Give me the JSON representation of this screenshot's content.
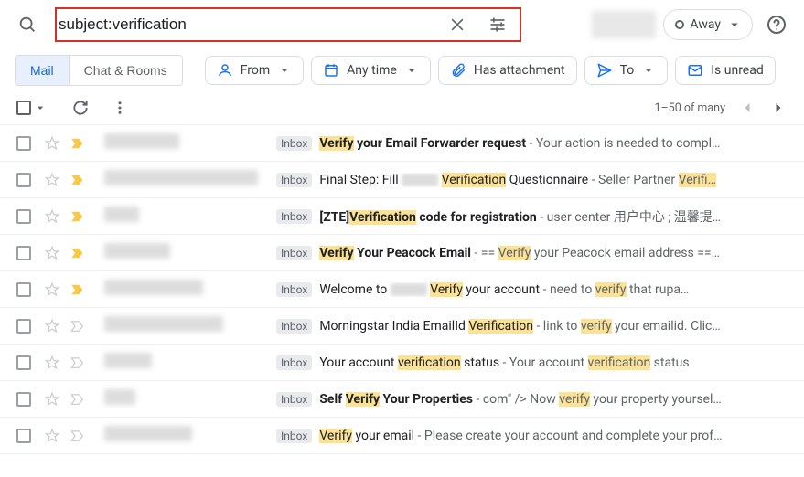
{
  "search": {
    "value": "subject:verification"
  },
  "status_chip": {
    "label": "Away"
  },
  "tabs": {
    "mail": "Mail",
    "chat": "Chat & Rooms"
  },
  "chips": {
    "from": "From",
    "anytime": "Any time",
    "has_attachment": "Has attachment",
    "to": "To",
    "is_unread": "Is unread"
  },
  "pager": {
    "range": "1–50 of many"
  },
  "inbox_label": "Inbox",
  "rows": [
    {
      "important": true,
      "sender_blur_width": 82,
      "bold": true,
      "segments": [
        {
          "t": "Verify",
          "cls": "s-bold hl"
        },
        {
          "t": " your Email Forwarder request",
          "cls": "s-bold"
        },
        {
          "t": " - Your action is needed to compl…",
          "cls": "s-prev"
        }
      ]
    },
    {
      "important": true,
      "sender_blur_width": 168,
      "bold": false,
      "segments": [
        {
          "t": "Final Step: Fill ",
          "cls": "s-reg"
        },
        {
          "blur": true
        },
        {
          "t": " ",
          "cls": "s-reg"
        },
        {
          "t": "Verification",
          "cls": "s-reg hl"
        },
        {
          "t": " Questionnaire",
          "cls": "s-reg"
        },
        {
          "t": " - Seller Partner ",
          "cls": "s-prev"
        },
        {
          "t": "Verifi…",
          "cls": "s-prev hl"
        }
      ]
    },
    {
      "important": true,
      "sender_blur_width": 38,
      "bold": true,
      "segments": [
        {
          "t": "[ZTE]",
          "cls": "s-bold"
        },
        {
          "t": "Verification",
          "cls": "s-bold hl"
        },
        {
          "t": " code for registration",
          "cls": "s-bold"
        },
        {
          "t": " - user center 用户中心 ; 温馨提…",
          "cls": "s-prev"
        }
      ]
    },
    {
      "important": true,
      "sender_blur_width": 72,
      "bold": true,
      "segments": [
        {
          "t": "Verify",
          "cls": "s-bold hl"
        },
        {
          "t": " Your Peacock Email",
          "cls": "s-bold"
        },
        {
          "t": " - == ",
          "cls": "s-prev"
        },
        {
          "t": "Verify",
          "cls": "s-prev hl"
        },
        {
          "t": " your Peacock email address ==…",
          "cls": "s-prev"
        }
      ]
    },
    {
      "important": true,
      "sender_blur_width": 108,
      "bold": false,
      "segments": [
        {
          "t": "Welcome to ",
          "cls": "s-reg"
        },
        {
          "blur": true
        },
        {
          "t": " ",
          "cls": "s-reg"
        },
        {
          "t": "Verify",
          "cls": "s-reg hl"
        },
        {
          "t": " your account",
          "cls": "s-reg"
        },
        {
          "t": " - need to ",
          "cls": "s-prev"
        },
        {
          "t": "verify",
          "cls": "s-prev hl"
        },
        {
          "t": " that rupa…",
          "cls": "s-prev"
        }
      ]
    },
    {
      "important": false,
      "sender_blur_width": 130,
      "bold": false,
      "segments": [
        {
          "t": "Morningstar India EmailId ",
          "cls": "s-reg"
        },
        {
          "t": "Verification",
          "cls": "s-reg hl"
        },
        {
          "t": " - link to ",
          "cls": "s-prev"
        },
        {
          "t": "verify",
          "cls": "s-prev hl"
        },
        {
          "t": " your emailid. Clic…",
          "cls": "s-prev"
        }
      ]
    },
    {
      "important": false,
      "sender_blur_width": 52,
      "bold": false,
      "segments": [
        {
          "t": "Your account ",
          "cls": "s-reg"
        },
        {
          "t": "verification",
          "cls": "s-reg hl"
        },
        {
          "t": " status",
          "cls": "s-reg"
        },
        {
          "t": " - Your account ",
          "cls": "s-prev"
        },
        {
          "t": "verification",
          "cls": "s-prev hl"
        },
        {
          "t": " status",
          "cls": "s-prev"
        }
      ]
    },
    {
      "important": false,
      "sender_blur_width": 34,
      "bold": true,
      "segments": [
        {
          "t": "Self ",
          "cls": "s-bold"
        },
        {
          "t": "Verify",
          "cls": "s-bold hl"
        },
        {
          "t": " Your Properties",
          "cls": "s-bold"
        },
        {
          "t": " - com\" /> Now ",
          "cls": "s-prev"
        },
        {
          "t": "verify",
          "cls": "s-prev hl"
        },
        {
          "t": " your property yoursel…",
          "cls": "s-prev"
        }
      ]
    },
    {
      "important": false,
      "sender_blur_width": 96,
      "bold": false,
      "segments": [
        {
          "t": "Verify",
          "cls": "s-reg hl"
        },
        {
          "t": " your email",
          "cls": "s-reg"
        },
        {
          "t": " - Please create your account and complete your prof…",
          "cls": "s-prev"
        }
      ]
    }
  ]
}
